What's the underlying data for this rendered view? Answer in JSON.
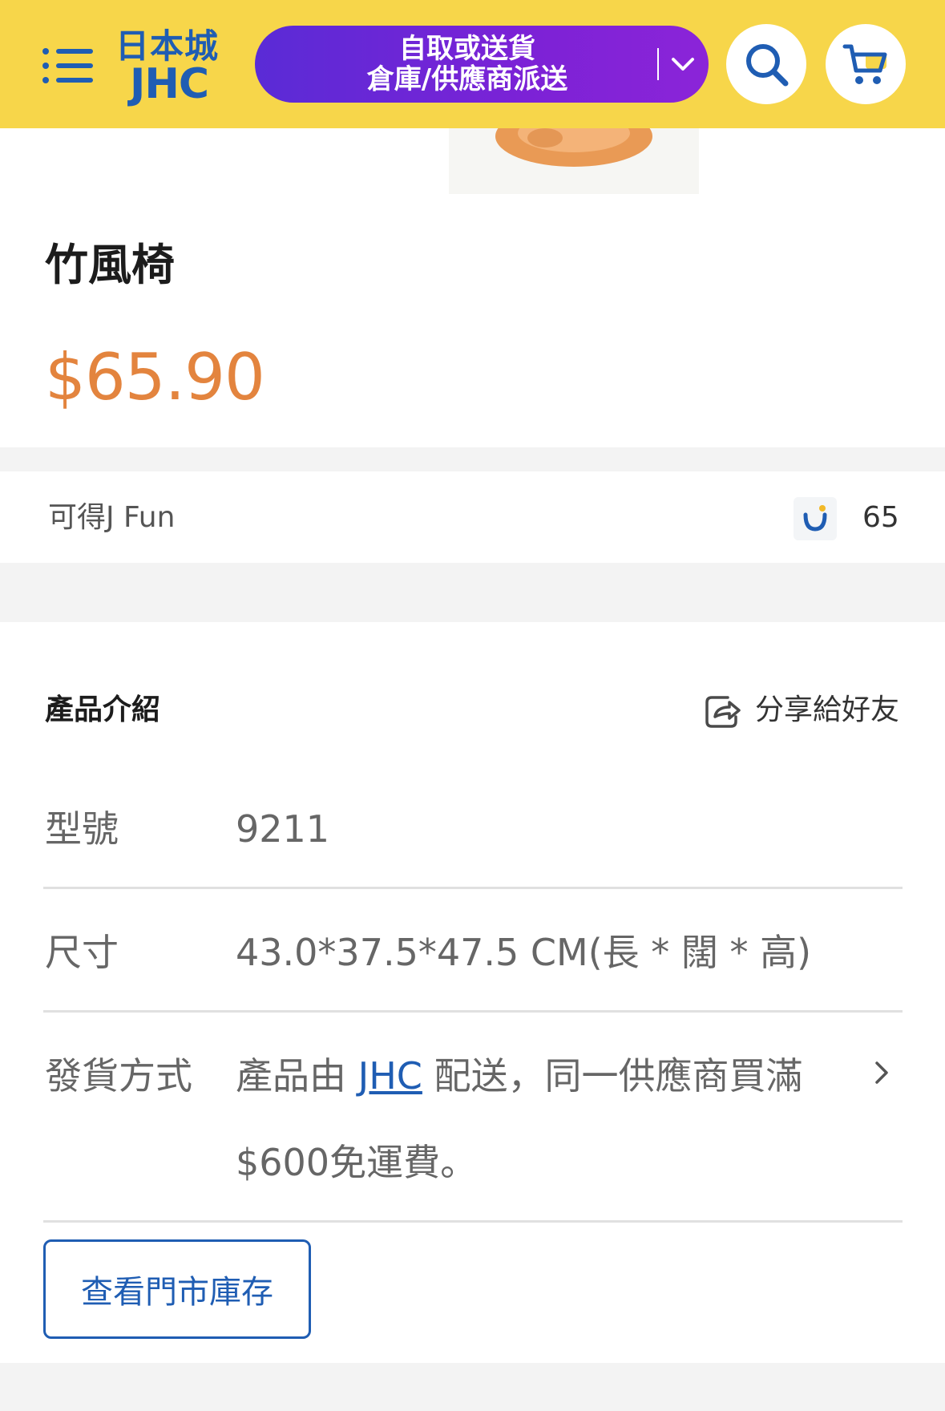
{
  "header": {
    "logo_text_top": "日本城",
    "logo_text_bottom": "JHC",
    "delivery_line1": "自取或送貨",
    "delivery_line2": "倉庫/供應商派送",
    "icons": [
      "menu-icon",
      "chevron-down-icon",
      "search-icon",
      "cart-icon"
    ],
    "background_color": "#f7d64a",
    "pill_color": "#7c22d6"
  },
  "product": {
    "title": "竹風椅",
    "price": "$65.90",
    "price_color": "#e3843e"
  },
  "jfun": {
    "label": "可得J Fun",
    "value": "65",
    "icon": "jfun-smile-icon"
  },
  "intro": {
    "title": "產品介紹",
    "share_label": "分享給好友",
    "share_icon": "share-icon"
  },
  "specs": {
    "model_label": "型號",
    "model_value": "9211",
    "size_label": "尺寸",
    "size_value": "43.0*37.5*47.5 CM(長 * 闊 * 高)",
    "shipping_label": "發貨方式",
    "shipping_prefix": "產品由 ",
    "shipping_link": "JHC",
    "shipping_suffix": " 配送，同一供應商買滿",
    "shipping_line2": "$600免運費。"
  },
  "store_stock_button": "查看門市庫存",
  "accent_color": "#1f5db3"
}
